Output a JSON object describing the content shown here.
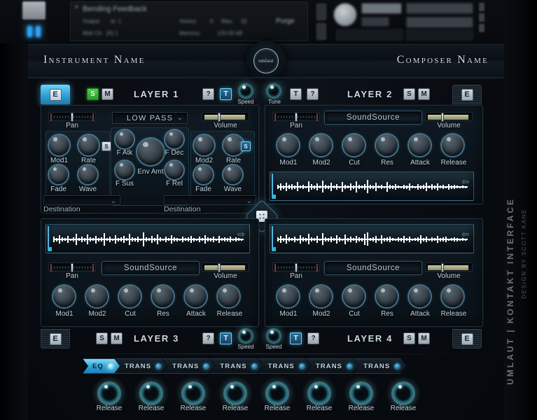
{
  "host": {
    "preset_name": "Bending Feedback",
    "output_label": "Output",
    "output_value": "st. 1",
    "midi_label": "Midi Ch:",
    "midi_value": "[A] 1",
    "voices_label": "Voices:",
    "voices_value": "0",
    "max_label": "Max:",
    "max_value": "32",
    "purge_label": "Purge",
    "memory_label": "Memory:",
    "memory_value": "120.00 kB"
  },
  "title": {
    "instrument": "Instrument Name",
    "composer": "Composer Name",
    "logo_text": "umlaut"
  },
  "branding": {
    "line1": "UMLAUT  |  KONTAKT INTERFACE",
    "line2": "DESIGN BY SCOTT KANE"
  },
  "colors": {
    "accent_cyan": "#6fd4f7",
    "solo_green": "#4fd04f",
    "panel_bg": "#101a23",
    "text_primary": "#cdd8e2"
  },
  "layer1": {
    "name": "LAYER 1",
    "edit_label": "E",
    "solo_label": "S",
    "mute_label": "M",
    "help_label": "?",
    "tune_label": "T",
    "speed_label": "Speed",
    "filter_type": "LOW PASS",
    "pan_label": "Pan",
    "volume_label": "Volume",
    "lfo1": {
      "knobs": [
        "Mod1",
        "Rate",
        "Fade",
        "Wave"
      ],
      "sync_label": "S",
      "destination_label": "Destination"
    },
    "lfo2": {
      "knobs": [
        "Mod2",
        "Rate",
        "Fade",
        "Wave"
      ],
      "sync_label": "S",
      "destination_label": "Destination"
    },
    "env": {
      "knobs": [
        "F Atk",
        "F Dec",
        "F Sus",
        "F Rel"
      ],
      "center_knob": "Env Amt"
    }
  },
  "layer2": {
    "name": "LAYER 2",
    "edit_label": "E",
    "solo_label": "S",
    "mute_label": "M",
    "help_label": "?",
    "tune_btn_label": "T",
    "tune_knob_label": "Tune",
    "sound_source": "SoundSource",
    "pan_label": "Pan",
    "volume_label": "Volume",
    "knobs": [
      "Mod1",
      "Mod2",
      "Cut",
      "Res",
      "Attack",
      "Release"
    ]
  },
  "layer3": {
    "name": "LAYER 3",
    "edit_label": "E",
    "solo_label": "S",
    "mute_label": "M",
    "help_label": "?",
    "tune_label": "T",
    "speed_label": "Speed",
    "sound_source": "SoundSource",
    "pan_label": "Pan",
    "volume_label": "Volume",
    "knobs": [
      "Mod1",
      "Mod2",
      "Cut",
      "Res",
      "Attack",
      "Release"
    ]
  },
  "layer4": {
    "name": "LAYER 4",
    "edit_label": "E",
    "solo_label": "S",
    "mute_label": "M",
    "help_label": "?",
    "tune_label": "T",
    "speed_label": "Speed",
    "sound_source": "SoundSource",
    "pan_label": "Pan",
    "volume_label": "Volume",
    "knobs": [
      "Mod1",
      "Mod2",
      "Cut",
      "Res",
      "Attack",
      "Release"
    ]
  },
  "fx": {
    "slots": [
      {
        "label": "EQ",
        "active": true
      },
      {
        "label": "TRANS",
        "active": false
      },
      {
        "label": "TRANS",
        "active": false
      },
      {
        "label": "TRANS",
        "active": false
      },
      {
        "label": "TRANS",
        "active": false
      },
      {
        "label": "TRANS",
        "active": false
      },
      {
        "label": "TRANS",
        "active": false
      }
    ],
    "knobs": [
      "Release",
      "Release",
      "Release",
      "Release",
      "Release",
      "Release",
      "Release",
      "Release"
    ]
  }
}
